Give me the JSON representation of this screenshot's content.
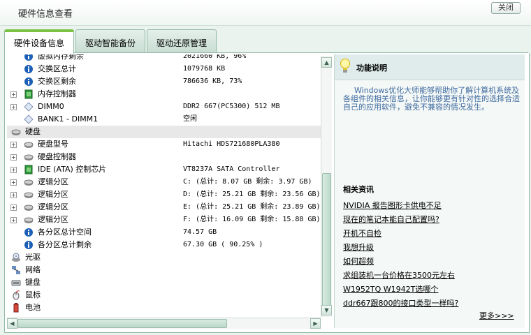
{
  "window": {
    "title": "硬件信息查看",
    "close_label": "关闭"
  },
  "tabs": [
    {
      "label": "硬件设备信息",
      "active": true
    },
    {
      "label": "驱动智能备份",
      "active": false
    },
    {
      "label": "驱动还原管理",
      "active": false
    }
  ],
  "tree": [
    {
      "icon": "info-icon",
      "expander": "",
      "label": "虚拟内存剩余",
      "value": "2021660 KB, 96%"
    },
    {
      "icon": "info-icon",
      "expander": "",
      "label": "交换区总计",
      "value": "1079768 KB"
    },
    {
      "icon": "info-icon",
      "expander": "",
      "label": "交换区剩余",
      "value": "786636 KB, 73%"
    },
    {
      "icon": "chip-icon",
      "expander": "+",
      "label": "内存控制器",
      "value": ""
    },
    {
      "icon": "memory-slot-icon",
      "expander": "+",
      "label": "DIMM0",
      "value": "DDR2 667(PC5300) 512 MB"
    },
    {
      "icon": "memory-slot-icon",
      "expander": "",
      "label": "BANK1 - DIMM1",
      "value": "空闲"
    },
    {
      "icon": "disk-icon",
      "expander": "",
      "label": "硬盘",
      "value": "",
      "selected": true
    },
    {
      "icon": "disk-icon",
      "expander": "+",
      "label": "硬盘型号",
      "value": "Hitachi HDS721680PLA380"
    },
    {
      "icon": "disk-icon",
      "expander": "+",
      "label": "硬盘控制器",
      "value": ""
    },
    {
      "icon": "chip-icon",
      "expander": "+",
      "label": "IDE (ATA) 控制芯片",
      "value": "VT8237A SATA Controller"
    },
    {
      "icon": "disk-icon",
      "expander": "+",
      "label": "逻辑分区",
      "value": "C: (总计: 8.07 GB 剩余: 3.97 GB)"
    },
    {
      "icon": "disk-icon",
      "expander": "+",
      "label": "逻辑分区",
      "value": "D: (总计: 25.21 GB 剩余: 23.56 GB)"
    },
    {
      "icon": "disk-icon",
      "expander": "+",
      "label": "逻辑分区",
      "value": "E: (总计: 25.21 GB 剩余: 23.89 GB)"
    },
    {
      "icon": "disk-icon",
      "expander": "+",
      "label": "逻辑分区",
      "value": "F: (总计: 16.09 GB 剩余: 15.88 GB)"
    },
    {
      "icon": "info-icon",
      "expander": "",
      "label": "各分区总计空间",
      "value": "74.57 GB"
    },
    {
      "icon": "info-icon",
      "expander": "",
      "label": "各分区总计剩余",
      "value": "67.30 GB ( 90.25% )"
    },
    {
      "icon": "cd-drive-icon",
      "expander": "",
      "label": "光驱",
      "value": "",
      "top": true
    },
    {
      "icon": "network-icon",
      "expander": "",
      "label": "网络",
      "value": "",
      "top": true
    },
    {
      "icon": "keyboard-icon",
      "expander": "",
      "label": "键盘",
      "value": "",
      "top": true
    },
    {
      "icon": "mouse-icon",
      "expander": "",
      "label": "鼠标",
      "value": "",
      "top": true
    },
    {
      "icon": "battery-icon",
      "expander": "",
      "label": "电池",
      "value": "",
      "top": true
    }
  ],
  "function_panel": {
    "title": "功能说明",
    "description": "Windows优化大师能够帮助你了解计算机系统及各组件的相关信息，让你能够更有针对性的选择合适自己的应用软件，避免不兼容的情况发生。"
  },
  "related": {
    "title": "相关资讯",
    "links": [
      "NVIDIA 报告图形卡供电不足",
      "现在的笔记本能自己配置吗?",
      "开机不自检",
      "我想升级",
      "如何超频",
      "求组装机一台价格在3500元左右",
      "W1952TQ W1942T选哪个",
      "ddr667跟800的接口类型一样吗?"
    ],
    "more": "更多>>>"
  },
  "colors": {
    "accent": "#7cc242",
    "link_text": "#3e6aa0",
    "border": "#93b9a7"
  }
}
